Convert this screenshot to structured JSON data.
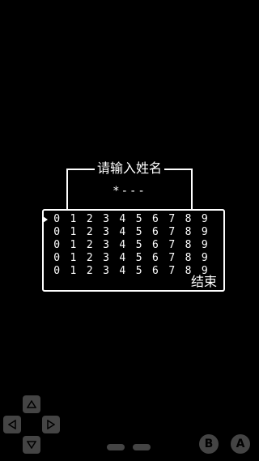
{
  "name_entry": {
    "title": "请输入姓名",
    "value": "*---"
  },
  "grid": {
    "rows": [
      [
        "0",
        "1",
        "2",
        "3",
        "4",
        "5",
        "6",
        "7",
        "8",
        "9"
      ],
      [
        "0",
        "1",
        "2",
        "3",
        "4",
        "5",
        "6",
        "7",
        "8",
        "9"
      ],
      [
        "0",
        "1",
        "2",
        "3",
        "4",
        "5",
        "6",
        "7",
        "8",
        "9"
      ],
      [
        "0",
        "1",
        "2",
        "3",
        "4",
        "5",
        "6",
        "7",
        "8",
        "9"
      ],
      [
        "0",
        "1",
        "2",
        "3",
        "4",
        "5",
        "6",
        "7",
        "8",
        "9"
      ]
    ],
    "end_label": "结束"
  },
  "controls": {
    "b_label": "B",
    "a_label": "A",
    "dpad_icons": [
      "arrow-up-icon",
      "arrow-left-icon",
      "arrow-right-icon",
      "arrow-down-icon"
    ]
  },
  "colors": {
    "background": "#000000",
    "text": "#ffffff",
    "control": "#444444"
  }
}
